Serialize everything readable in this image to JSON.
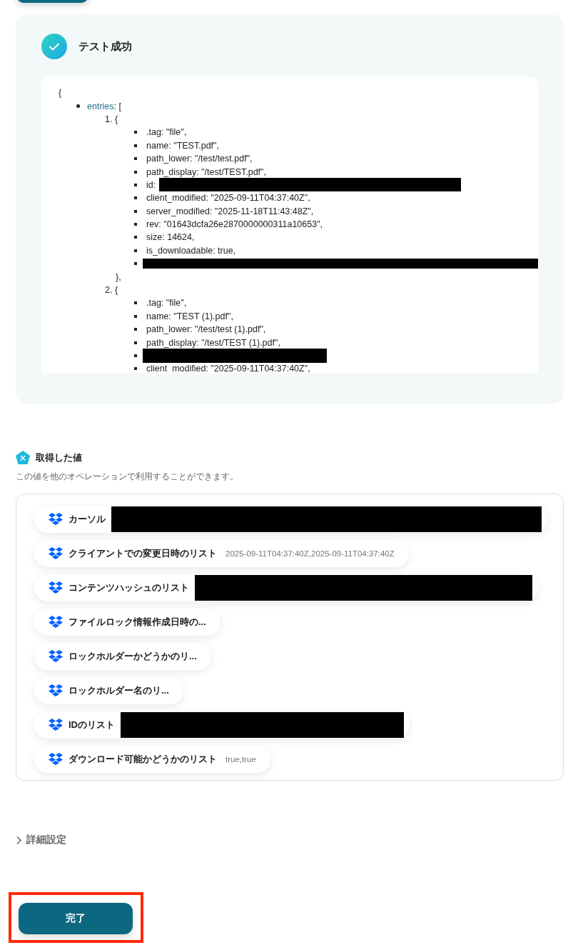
{
  "test_result": {
    "succeeded": true,
    "title": "テスト成功",
    "output": {
      "open": "{",
      "key": "entries",
      "bracket": ": [",
      "items": [
        {
          "number": "1.",
          "open": "{",
          "close": "},",
          "fields": [
            {
              "text": ".tag: \"file\","
            },
            {
              "text": "name: \"TEST.pdf\","
            },
            {
              "text": "path_lower: \"/test/test.pdf\","
            },
            {
              "text": "path_display: \"/test/TEST.pdf\","
            },
            {
              "text": "id:",
              "redacted": true
            },
            {
              "text": "client_modified: \"2025-09-11T04:37:40Z\","
            },
            {
              "text": "server_modified: \"2025-11-18T11:43:48Z\","
            },
            {
              "text": "rev: \"01643dcfa26e2870000000311a10653\","
            },
            {
              "text": "size: 14624,"
            },
            {
              "text": "is_downloadable: true,"
            },
            {
              "redacted": true
            }
          ]
        },
        {
          "number": "2.",
          "open": "{",
          "fields": [
            {
              "text": ".tag: \"file\","
            },
            {
              "text": "name: \"TEST (1).pdf\","
            },
            {
              "text": "path_lower: \"/test/test (1).pdf\","
            },
            {
              "text": "path_display: \"/test/TEST (1).pdf\","
            },
            {
              "redacted": true
            },
            {
              "text": "client_modified: \"2025-09-11T04:37:40Z\","
            }
          ]
        }
      ]
    }
  },
  "obtained_values": {
    "title": "取得した値",
    "description": "この値を他のオペレーションで利用することができます。",
    "items": [
      {
        "label": "カーソル",
        "redacted": true
      },
      {
        "label": "クライアントでの変更日時のリスト",
        "value": "2025-09-11T04:37:40Z,2025-09-11T04:37:40Z"
      },
      {
        "label": "コンテンツハッシュのリスト",
        "redacted": true
      },
      {
        "label": "ファイルロック情報作成日時の..."
      },
      {
        "label": "ロックホルダーかどうかのリ..."
      },
      {
        "label": "ロックホルダー名のリ..."
      },
      {
        "label": "IDのリスト",
        "redacted": true
      },
      {
        "label": "ダウンロード可能かどうかのリスト",
        "value": "true,true"
      }
    ]
  },
  "advanced": {
    "label": "詳細設定",
    "expanded": false
  },
  "done_button": {
    "label": "完了",
    "highlighted": true
  }
}
